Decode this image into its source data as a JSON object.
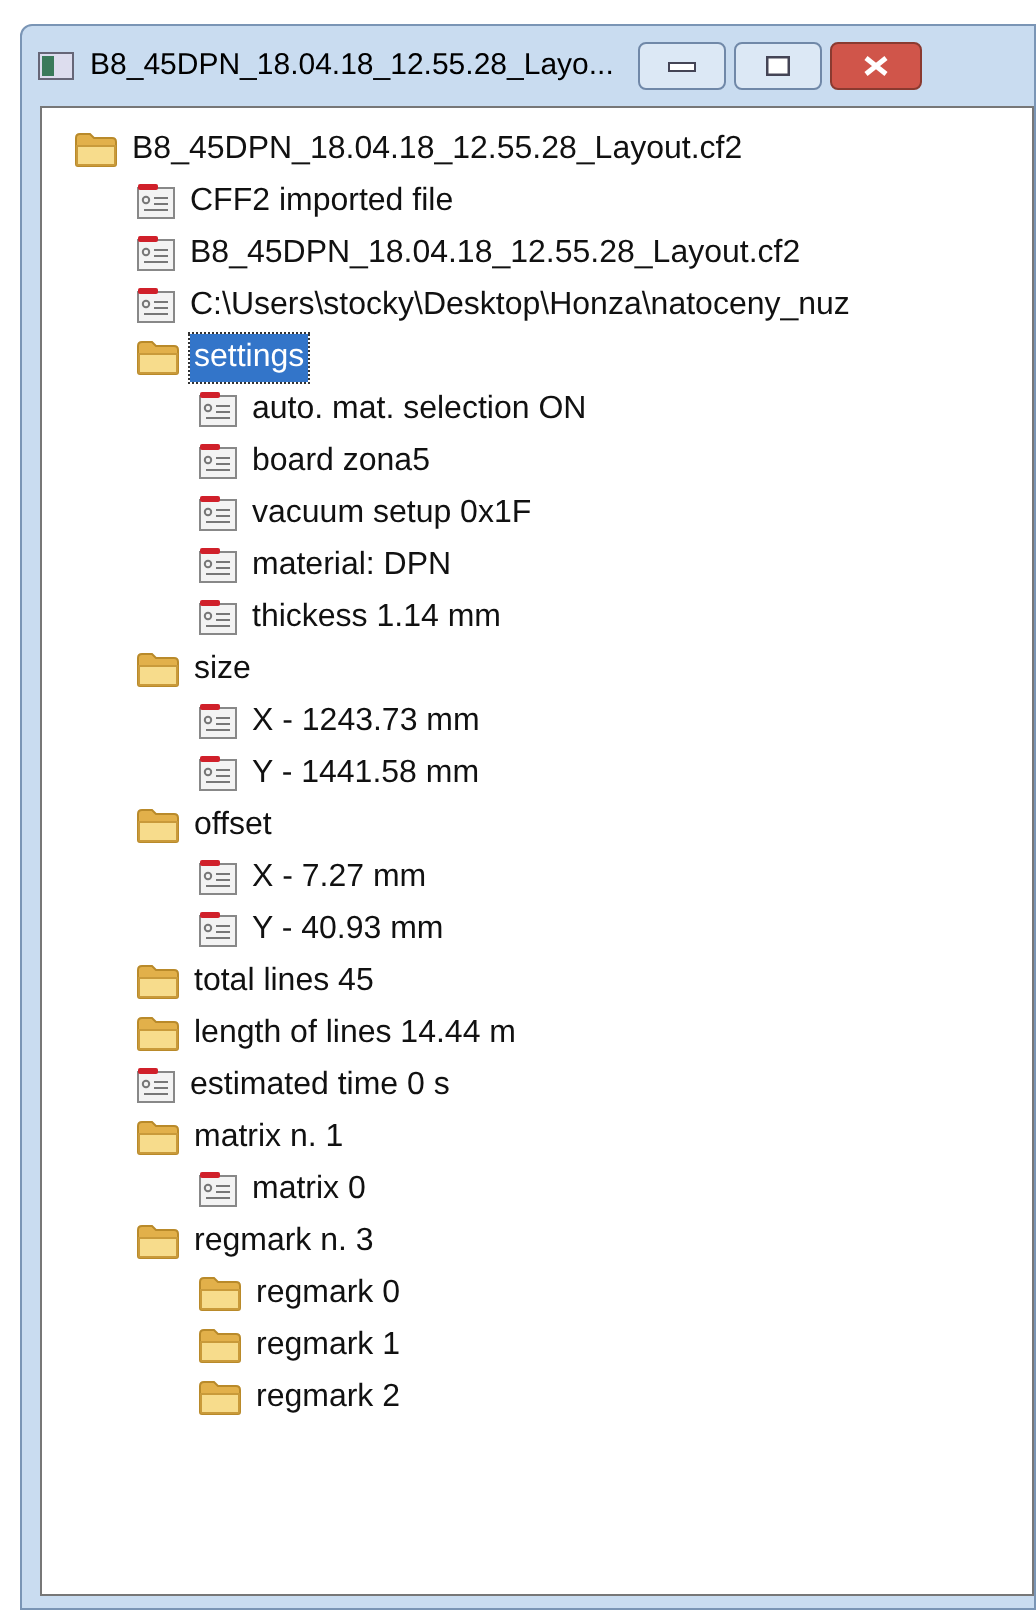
{
  "window": {
    "title": "B8_45DPN_18.04.18_12.55.28_Layo..."
  },
  "tree": [
    {
      "label": "B8_45DPN_18.04.18_12.55.28_Layout.cf2",
      "kind": "folder",
      "selected": false,
      "children": [
        {
          "label": "CFF2 imported file",
          "kind": "file",
          "selected": false
        },
        {
          "label": "B8_45DPN_18.04.18_12.55.28_Layout.cf2",
          "kind": "file",
          "selected": false
        },
        {
          "label": "C:\\Users\\stocky\\Desktop\\Honza\\natoceny_nuz",
          "kind": "file",
          "selected": false
        },
        {
          "label": "settings",
          "kind": "folder",
          "selected": true,
          "children": [
            {
              "label": "auto. mat. selection ON",
              "kind": "file",
              "selected": false
            },
            {
              "label": "board zona5",
              "kind": "file",
              "selected": false
            },
            {
              "label": "vacuum setup 0x1F",
              "kind": "file",
              "selected": false
            },
            {
              "label": "material: DPN",
              "kind": "file",
              "selected": false
            },
            {
              "label": "thickess 1.14 mm",
              "kind": "file",
              "selected": false
            }
          ]
        },
        {
          "label": "size",
          "kind": "folder",
          "selected": false,
          "children": [
            {
              "label": "X - 1243.73 mm",
              "kind": "file",
              "selected": false
            },
            {
              "label": "Y - 1441.58 mm",
              "kind": "file",
              "selected": false
            }
          ]
        },
        {
          "label": "offset",
          "kind": "folder",
          "selected": false,
          "children": [
            {
              "label": "X - 7.27 mm",
              "kind": "file",
              "selected": false
            },
            {
              "label": "Y - 40.93 mm",
              "kind": "file",
              "selected": false
            }
          ]
        },
        {
          "label": "total lines 45",
          "kind": "folder",
          "selected": false
        },
        {
          "label": "length of lines 14.44 m",
          "kind": "folder",
          "selected": false
        },
        {
          "label": "estimated time 0 s",
          "kind": "file",
          "selected": false
        },
        {
          "label": "matrix n. 1",
          "kind": "folder",
          "selected": false,
          "children": [
            {
              "label": "matrix 0",
              "kind": "file",
              "selected": false
            }
          ]
        },
        {
          "label": "regmark n. 3",
          "kind": "folder",
          "selected": false,
          "children": [
            {
              "label": "regmark 0",
              "kind": "folder",
              "selected": false
            },
            {
              "label": "regmark 1",
              "kind": "folder",
              "selected": false
            },
            {
              "label": "regmark 2",
              "kind": "folder",
              "selected": false
            }
          ]
        }
      ]
    }
  ]
}
